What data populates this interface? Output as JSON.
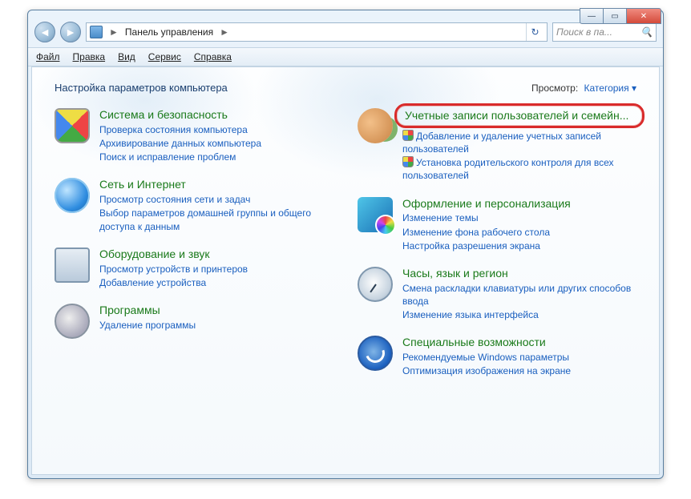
{
  "window": {
    "min": "—",
    "max": "▭",
    "close": "✕"
  },
  "nav": {
    "back_glyph": "◄",
    "fwd_glyph": "►",
    "address_label": "Панель управления",
    "address_sep": "►",
    "refresh_glyph": "↻",
    "search_placeholder": "Поиск в па...",
    "search_glyph": "🔍"
  },
  "menu": {
    "file": "Файл",
    "edit": "Правка",
    "view": "Вид",
    "tools": "Сервис",
    "help": "Справка"
  },
  "header": {
    "title": "Настройка параметров компьютера",
    "view_label": "Просмотр:",
    "view_value": "Категория",
    "view_arrow": "▾"
  },
  "left": [
    {
      "icon": "ic-shield",
      "name": "system-security",
      "title": "Система и безопасность",
      "links": [
        {
          "text": "Проверка состояния компьютера",
          "shield": false
        },
        {
          "text": "Архивирование данных компьютера",
          "shield": false
        },
        {
          "text": "Поиск и исправление проблем",
          "shield": false
        }
      ]
    },
    {
      "icon": "ic-net",
      "name": "network-internet",
      "title": "Сеть и Интернет",
      "links": [
        {
          "text": "Просмотр состояния сети и задач",
          "shield": false
        },
        {
          "text": "Выбор параметров домашней группы и общего доступа к данным",
          "shield": false
        }
      ]
    },
    {
      "icon": "ic-hw",
      "name": "hardware-sound",
      "title": "Оборудование и звук",
      "links": [
        {
          "text": "Просмотр устройств и принтеров",
          "shield": false
        },
        {
          "text": "Добавление устройства",
          "shield": false
        }
      ]
    },
    {
      "icon": "ic-prog",
      "name": "programs",
      "title": "Программы",
      "links": [
        {
          "text": "Удаление программы",
          "shield": false
        }
      ]
    }
  ],
  "right": [
    {
      "icon": "ic-users",
      "name": "user-accounts",
      "title": "Учетные записи пользователей и семейн...",
      "highlight": true,
      "links": [
        {
          "text": "Добавление и удаление учетных записей пользователей",
          "shield": true
        },
        {
          "text": "Установка родительского контроля для всех пользователей",
          "shield": true
        }
      ]
    },
    {
      "icon": "ic-appear",
      "name": "appearance-personalization",
      "title": "Оформление и персонализация",
      "links": [
        {
          "text": "Изменение темы",
          "shield": false
        },
        {
          "text": "Изменение фона рабочего стола",
          "shield": false
        },
        {
          "text": "Настройка разрешения экрана",
          "shield": false
        }
      ]
    },
    {
      "icon": "ic-clock",
      "name": "clock-language-region",
      "title": "Часы, язык и регион",
      "links": [
        {
          "text": "Смена раскладки клавиатуры или других способов ввода",
          "shield": false
        },
        {
          "text": "Изменение языка интерфейса",
          "shield": false
        }
      ]
    },
    {
      "icon": "ic-access",
      "name": "ease-of-access",
      "title": "Специальные возможности",
      "links": [
        {
          "text": "Рекомендуемые Windows параметры",
          "shield": false
        },
        {
          "text": "Оптимизация изображения на экране",
          "shield": false
        }
      ]
    }
  ]
}
